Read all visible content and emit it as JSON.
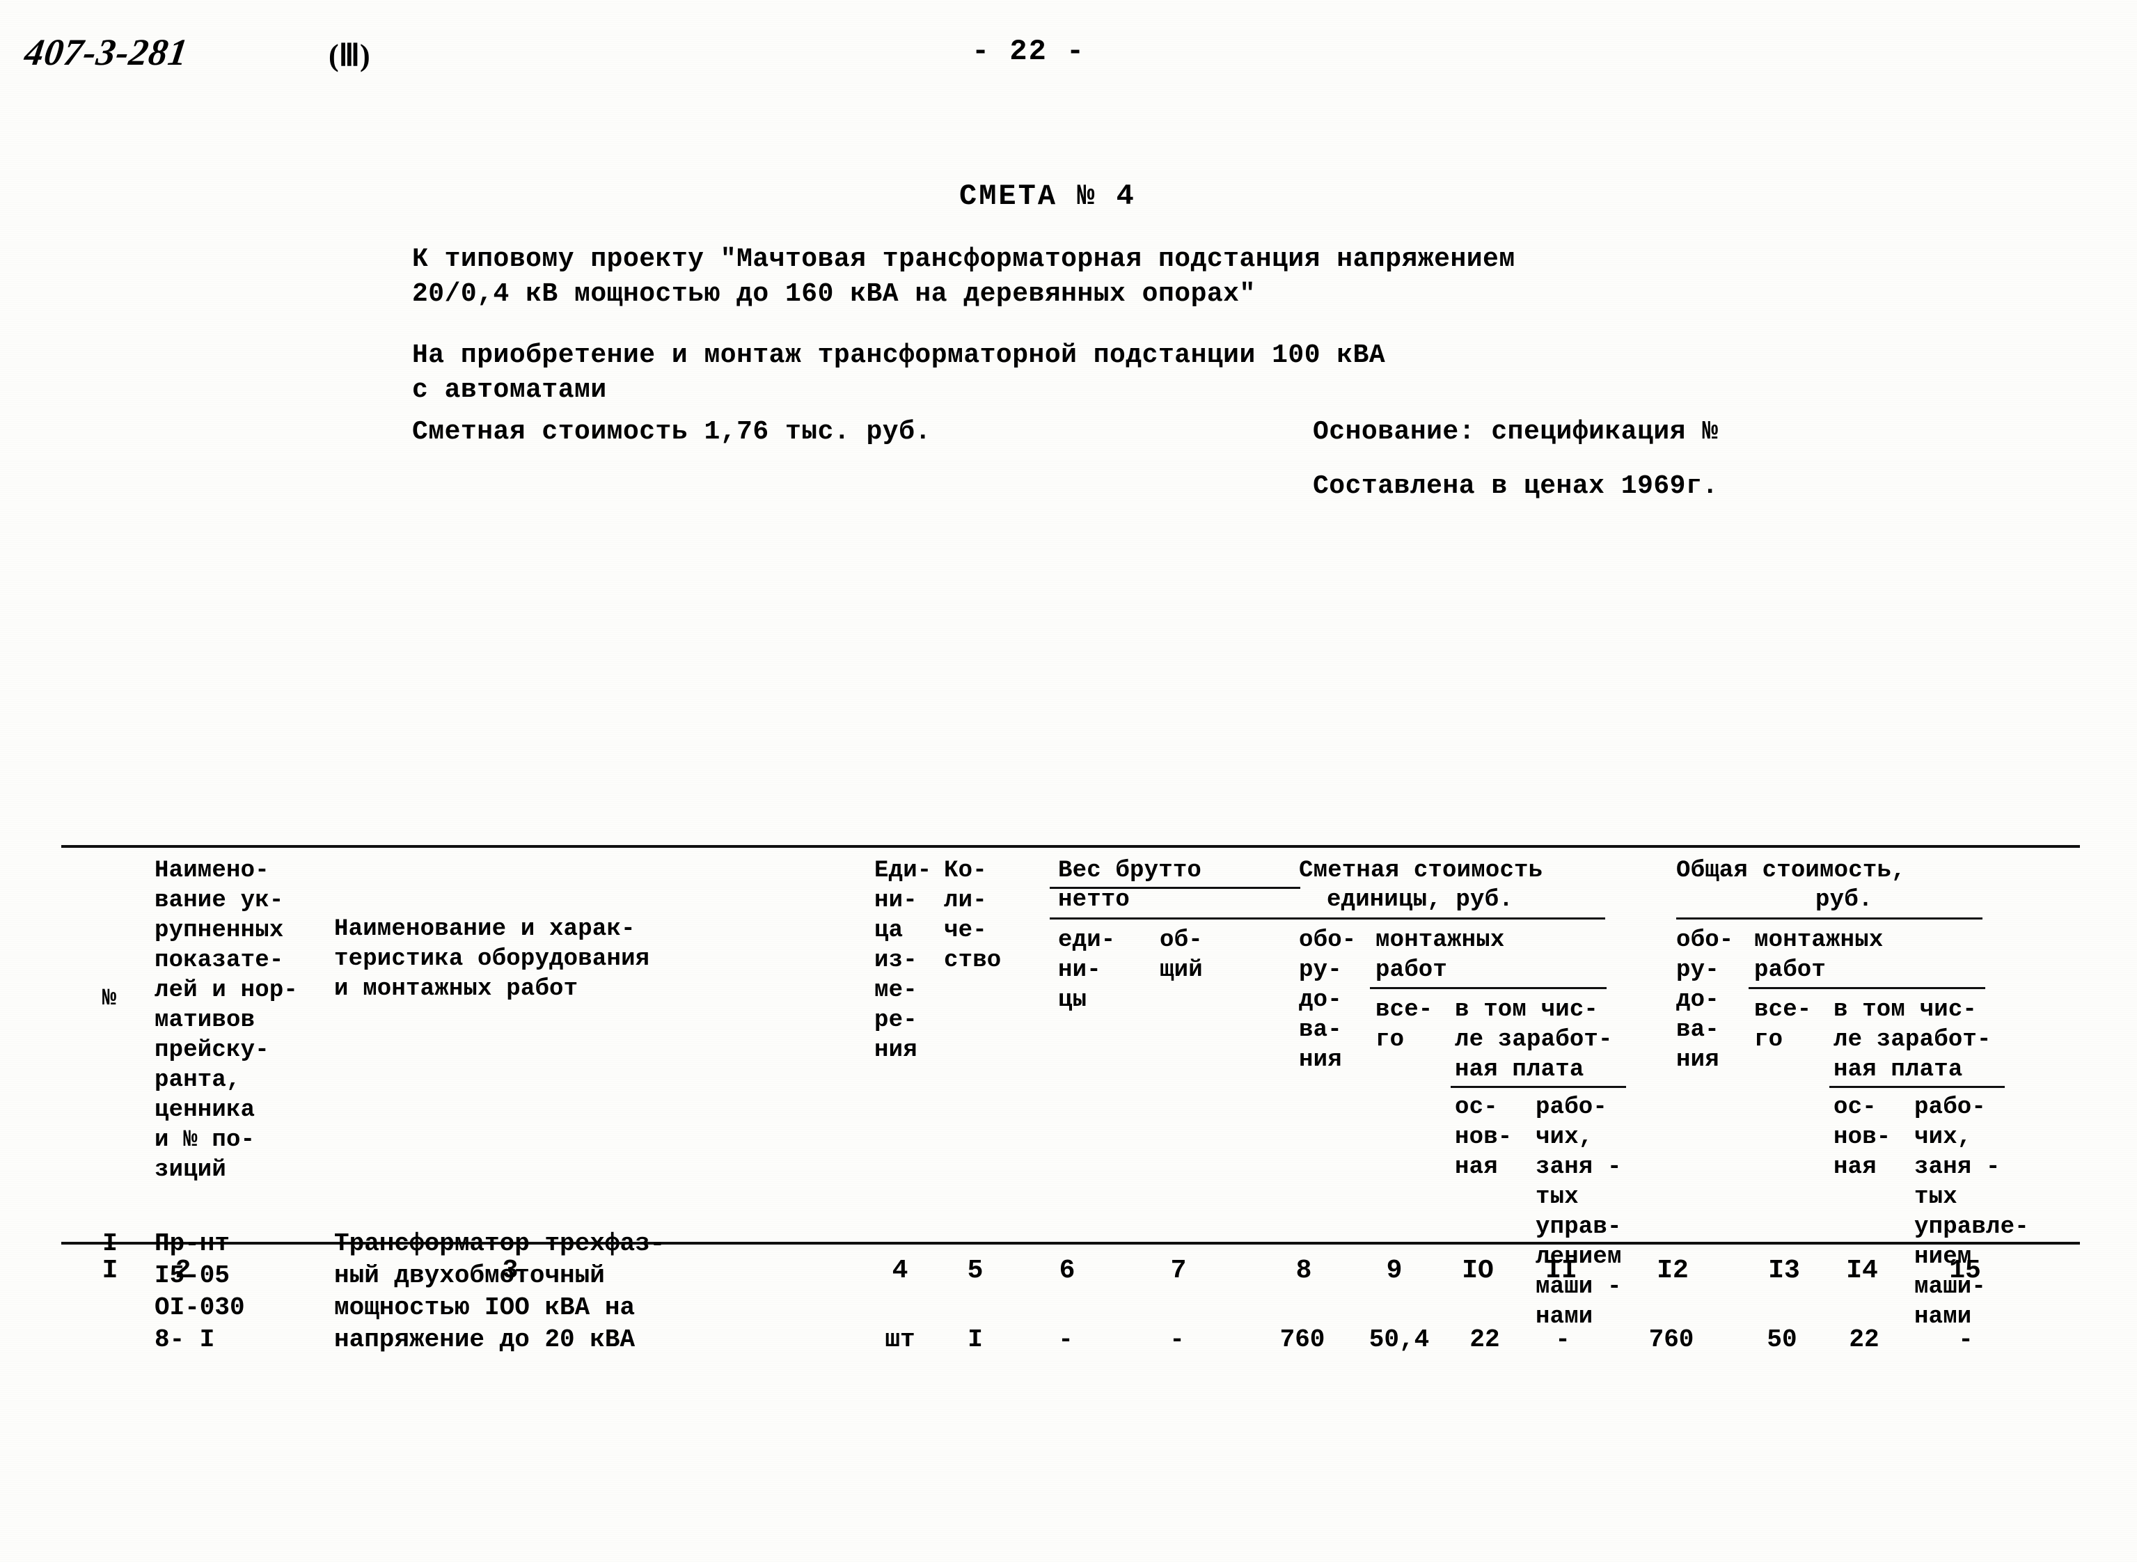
{
  "header": {
    "doc_code": "407-3-281",
    "part": "(Ⅲ)",
    "page_number": "- 22 -"
  },
  "sheet": {
    "title": "СМЕТА № 4",
    "intro_line_1": "К типовому проекту \"Мачтовая трансформаторная подстанция напряжением",
    "intro_line_2": "20/0,4 кВ мощностью до 160 кВА на деревянных опорах\"",
    "intro_line_3": "На приобретение и монтаж трансформаторной подстанции 100 кВА",
    "intro_line_4": "с автоматами",
    "cost_line": "Сметная стоимость 1,76 тыс. руб.",
    "basis_line": "Основание: спецификация №",
    "prices_line": "Составлена в ценах 1969г."
  },
  "table": {
    "headers": {
      "c1": "№",
      "c2": "Наимено-\nвание ук-\nрупненных\nпоказате-\nлей и нор-\nмативов\nпрейску-\nранта,\nценника\nи № по-\nзиций",
      "c3": "Наименование и харак-\nтеристика оборудования\nи монтажных работ",
      "c4": "Еди-\nни-\nца\nиз-\nме-\nре-\nния",
      "c5": "Ко-\nли-\nче-\nство",
      "c6_group_top": "Вес брутто",
      "c6_group_sub": "нетто",
      "c6": "еди-\nни-\nцы",
      "c7": "об-\nщий",
      "group_unit_cost": "Сметная стоимость",
      "group_unit_cost_sub": "единицы, руб.",
      "group_total_cost": "Общая стоимость,",
      "group_total_cost_sub": "руб.",
      "c8": "обо-\nру-\nдо-\nва-\nния",
      "mount_works_left": "монтажных\nработ",
      "c9": "все-\nго",
      "c10_11_top": "в том чис-\nле заработ-\nная плата",
      "c10": "ос-\nнов-\nная",
      "c11": "рабо-\nчих,\nзаня -\nтых\nуправ-\nлением\nмаши -\nнами",
      "c12": "обо-\nру-\nдо-\nва-\nния",
      "mount_works_right": "монтажных\nработ",
      "c13": "все-\nго",
      "c14_15_top": "в том чис-\nле заработ-\nная плата",
      "c14": "ос-\nнов-\nная",
      "c15": "рабо-\nчих,\nзаня -\nтых\nуправле-\nнием\nмаши-\nнами"
    },
    "column_numbers": [
      "I",
      "2",
      "3",
      "4",
      "5",
      "6",
      "7",
      "8",
      "9",
      "IO",
      "II",
      "I2",
      "I3",
      "I4",
      "15"
    ],
    "rows": [
      {
        "c1": "I",
        "c2": "Пр-нт\nI5-05\nOI-030\n8- I",
        "c3": "Трансформатор трехфаз-\nный двухобмоточный\nмощностью IОО кВА на\nнапряжение до 20 кВА",
        "c4": "шт",
        "c5": "I",
        "c6": "-",
        "c7": "-",
        "c8": "760",
        "c9": "50,4",
        "c10": "22",
        "c11": "-",
        "c12": "760",
        "c13": "50",
        "c14": "22",
        "c15": "-"
      }
    ]
  }
}
